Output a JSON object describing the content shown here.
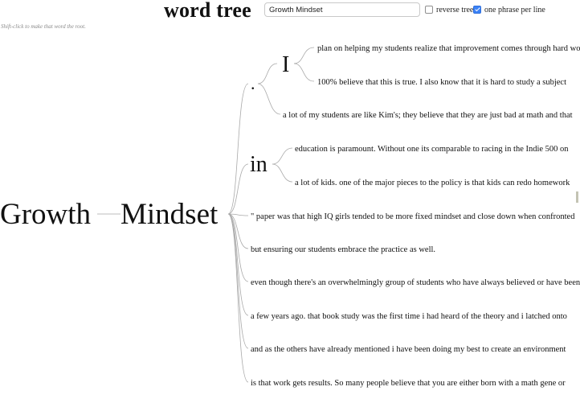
{
  "app": {
    "title": "word tree"
  },
  "search": {
    "value": "Growth Mindset"
  },
  "options": [
    {
      "label": "reverse tree",
      "checked": false
    },
    {
      "label": "one phrase per line",
      "checked": true
    }
  ],
  "hint": "Shift-click to make that word the root.",
  "tree": {
    "root": [
      "Growth",
      "Mindset"
    ],
    "nodes": [
      {
        "word": ".",
        "children": [
          {
            "word": "I",
            "children": [
              {
                "phrase": "plan on helping my students realize that improvement comes through hard work"
              },
              {
                "phrase": "100% believe that this is true. I also know that it is hard to study a subject"
              }
            ]
          },
          {
            "phrase": "a lot of my students are like Kim's; they believe that they are just bad at math and that"
          }
        ]
      },
      {
        "word": "in",
        "children": [
          {
            "phrase": "education is paramount. Without one its comparable to racing in the Indie 500 on"
          },
          {
            "phrase": "a lot of kids. one of the major pieces to the policy is that kids can redo homework"
          }
        ]
      },
      {
        "phrase": "\" paper was that high IQ girls tended to be more fixed mindset and close down when confronted"
      },
      {
        "phrase": "but ensuring our students embrace the practice as well."
      },
      {
        "phrase": "even though there's an overwhelmingly group of students who have always believed or have been"
      },
      {
        "phrase": "a few years ago. that book study was the first time i had heard of the theory and i latched onto"
      },
      {
        "phrase": "and as the others have already mentioned i have been doing my best to create an environment"
      },
      {
        "phrase": "is that work gets results. So many people believe that you are either born with a math gene or"
      }
    ]
  }
}
